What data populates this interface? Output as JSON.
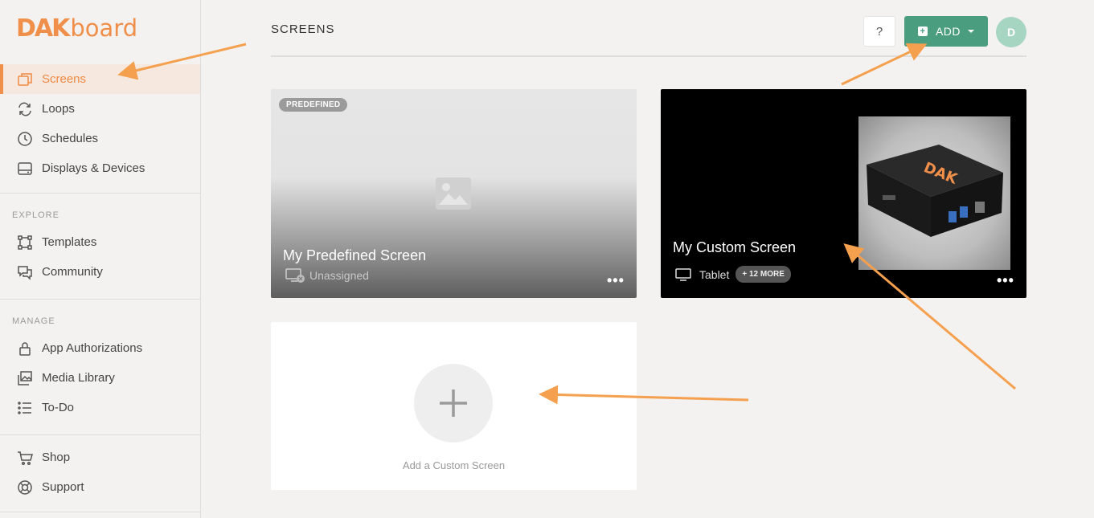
{
  "logo": {
    "part1": "DAK",
    "part2": "board"
  },
  "sidebar": {
    "main_items": [
      {
        "label": "Screens",
        "icon": "screens-icon",
        "active": true
      },
      {
        "label": "Loops",
        "icon": "loops-icon"
      },
      {
        "label": "Schedules",
        "icon": "clock-icon"
      },
      {
        "label": "Displays & Devices",
        "icon": "display-icon"
      }
    ],
    "explore_label": "EXPLORE",
    "explore_items": [
      {
        "label": "Templates",
        "icon": "templates-icon"
      },
      {
        "label": "Community",
        "icon": "chat-icon"
      }
    ],
    "manage_label": "MANAGE",
    "manage_items": [
      {
        "label": "App Authorizations",
        "icon": "lock-icon"
      },
      {
        "label": "Media Library",
        "icon": "images-icon"
      },
      {
        "label": "To-Do",
        "icon": "list-icon"
      }
    ],
    "bottom_items": [
      {
        "label": "Shop",
        "icon": "cart-icon"
      },
      {
        "label": "Support",
        "icon": "lifebuoy-icon"
      }
    ]
  },
  "header": {
    "title": "SCREENS",
    "help_label": "?",
    "add_label": "ADD",
    "avatar_initial": "D"
  },
  "cards": {
    "predefined": {
      "badge": "PREDEFINED",
      "title": "My Predefined Screen",
      "subtitle": "Unassigned",
      "menu": "•••"
    },
    "custom": {
      "title": "My Custom Screen",
      "device": "Tablet",
      "more": "+ 12 MORE",
      "menu": "•••"
    },
    "add": {
      "label": "Add a Custom Screen"
    }
  },
  "colors": {
    "accent": "#f08f4a",
    "add_button": "#4a9d7f",
    "avatar": "#a6d6c1",
    "annotation_arrow": "#f5a04f"
  }
}
